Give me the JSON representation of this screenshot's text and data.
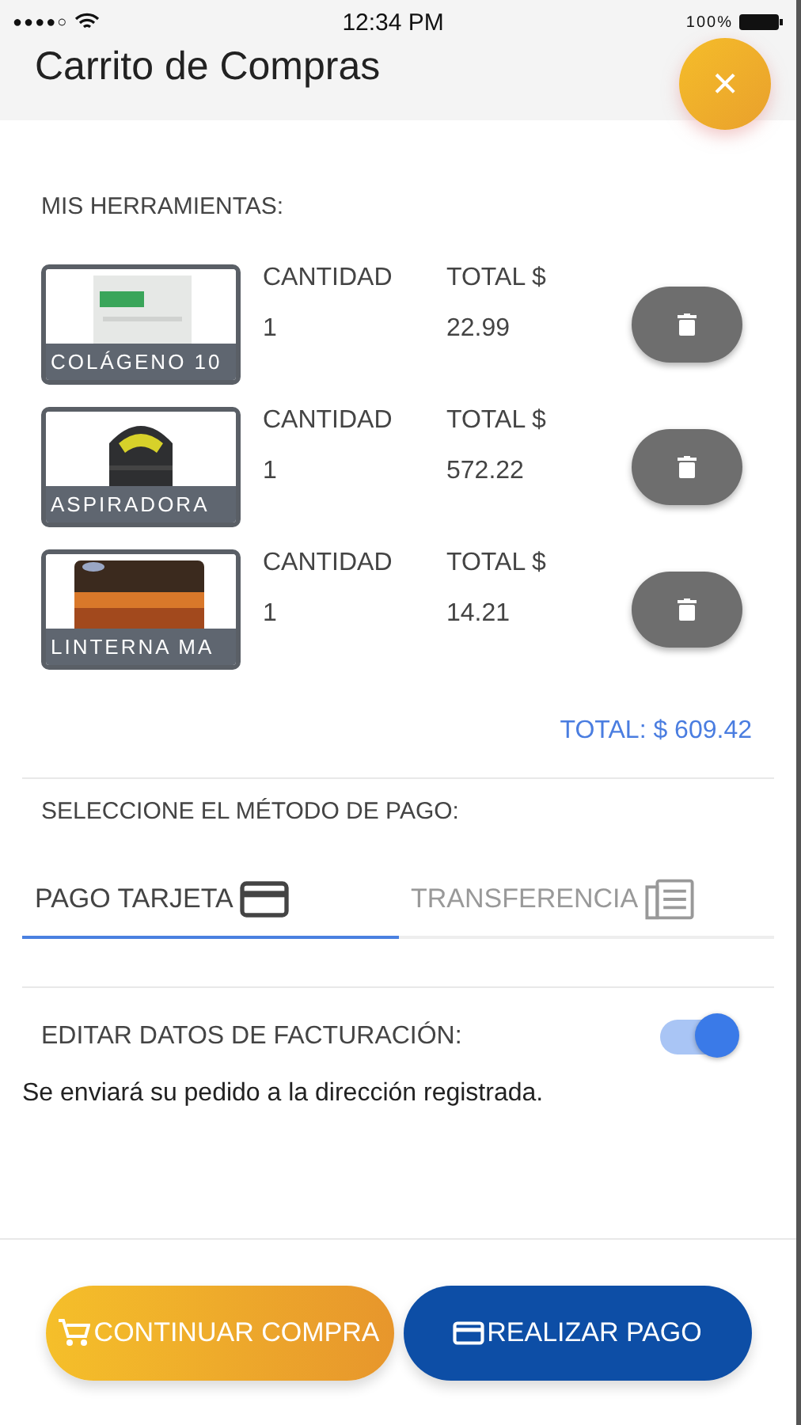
{
  "status_bar": {
    "carrier_dots": "●●●●○",
    "time": "12:34 PM",
    "battery": "100%"
  },
  "header": {
    "title": "Carrito de Compras",
    "close": "×"
  },
  "cart": {
    "heading": "MIS HERRAMIENTAS:",
    "items": [
      {
        "name": "COLÁGENO 10",
        "qty_label": "CANTIDAD",
        "total_label": "TOTAL $",
        "qty": "1",
        "total": "22.99",
        "kind": "pouch"
      },
      {
        "name": "ASPIRADORA",
        "qty_label": "CANTIDAD",
        "total_label": "TOTAL $",
        "qty": "1",
        "total": "572.22",
        "kind": "vacuum"
      },
      {
        "name": "LINTERNA MA",
        "qty_label": "CANTIDAD",
        "total_label": "TOTAL $",
        "qty": "1",
        "total": "14.21",
        "kind": "pack"
      }
    ],
    "total": "TOTAL: $ 609.42"
  },
  "payment": {
    "heading": "SELECCIONE EL MÉTODO DE PAGO:",
    "tabs": [
      {
        "label": "PAGO TARJETA",
        "kind": "card",
        "selected": true
      },
      {
        "label": "TRANSFERENCIA",
        "kind": "transfer",
        "selected": false
      }
    ]
  },
  "billing": {
    "label": "EDITAR DATOS DE FACTURACIÓN:",
    "on": true,
    "note": "Se enviará su pedido a la dirección registrada."
  },
  "buttons": [
    {
      "label": "CONTINUAR COMPRA",
      "kind": "secondary"
    },
    {
      "label": "REALIZAR PAGO",
      "kind": "primary"
    }
  ]
}
